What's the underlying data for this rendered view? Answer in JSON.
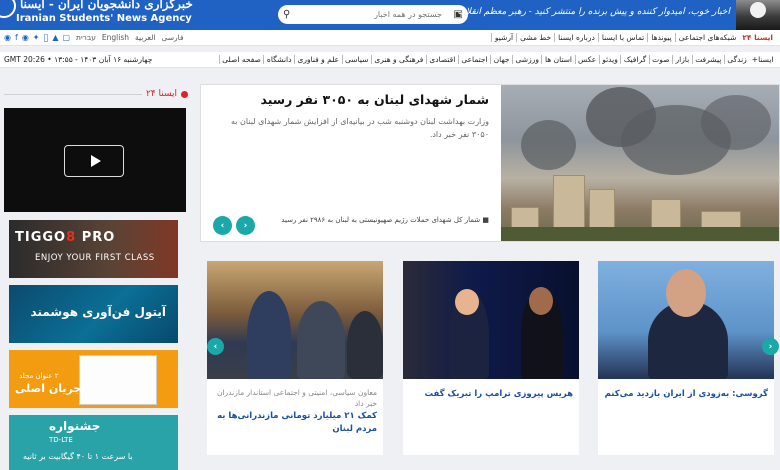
{
  "header": {
    "logo_fa": "خبرگزاری دانشجویان ایران - ایسنا",
    "logo_en": "Iranian Students' News Agency",
    "quote": "اخبار خوب، امیدوار کننده و پیش برنده را منتشر کنید - رهبر معظم انقلاب",
    "search_placeholder": "جستجو در همه اخبار"
  },
  "nav_top": {
    "items": [
      "آرشیو",
      "خط مشی",
      "درباره ایسنا",
      "تماس با ایسنا",
      "پیوندها",
      "شبکه‌های اجتماعی",
      "ایسنا ۲۴"
    ],
    "languages": [
      "English",
      "العربیة",
      "فارسی"
    ],
    "hebrew": "עברית"
  },
  "nav_cats": {
    "items": [
      "صفحه اصلی",
      "دانشگاه",
      "علم و فناوری",
      "سیاسی",
      "فرهنگی و هنری",
      "اقتصادی",
      "اجتماعی",
      "جهان",
      "ورزشی",
      "استان ها",
      "عکس",
      "ویدئو",
      "گرافیک",
      "صوت",
      "بازار",
      "پیشرفت",
      "زندگی",
      "ایسنا+"
    ],
    "date_time": "چهارشنبه ۱۶ آبان ۱۴۰۳ - ۱۳:۵۵ • GMT 20:26"
  },
  "sidebar": {
    "isna24_label": "ایسنا ۲۴",
    "ads": {
      "tiggo_title_a": "TIGGO",
      "tiggo_title_b": "8",
      "tiggo_title_c": "PRO",
      "tiggo_sub": "ENJOY YOUR FIRST CLASS",
      "tejarat": "آیتول فن‌آوری هوشمند",
      "jaryan_sub": "۲ عنوان مجلد",
      "jaryan": "جریان اصلی",
      "jashnvare": "جشنواره",
      "jashnvare_tag": "TD-LTE",
      "jashnvare_sub": "با سرعت ۱ تا ۴۰ گیگابیت بر ثانیه"
    }
  },
  "featured": {
    "title": "شمار شهدای لبنان به ۳۰۵۰ نفر رسید",
    "lead": "وزارت بهداشت لبنان دوشنبه شب در بیانیه‌ای از افزایش شمار شهدای لبنان به ۳۰۵۰ نفر خبر داد.",
    "related": "شمار کل شهدای حملات رژیم صهیونیستی به لبنان به ۲۹۸۶ نفر رسید"
  },
  "news": [
    {
      "category": "معاون سیاسی، امنیتی و اجتماعی استاندار مازندران خبر داد",
      "headline": "کمک ۲۱ میلیارد تومانی مازندرانی‌ها به مردم لبنان"
    },
    {
      "category": "",
      "headline": "هریس پیروزی ترامپ را تبریک گفت"
    },
    {
      "category": "",
      "headline": "گروسی: به‌زودی از ایران بازدید می‌کنم"
    }
  ],
  "icons": {
    "calendar": "calendar-icon",
    "search": "search-icon",
    "play": "play-icon"
  }
}
